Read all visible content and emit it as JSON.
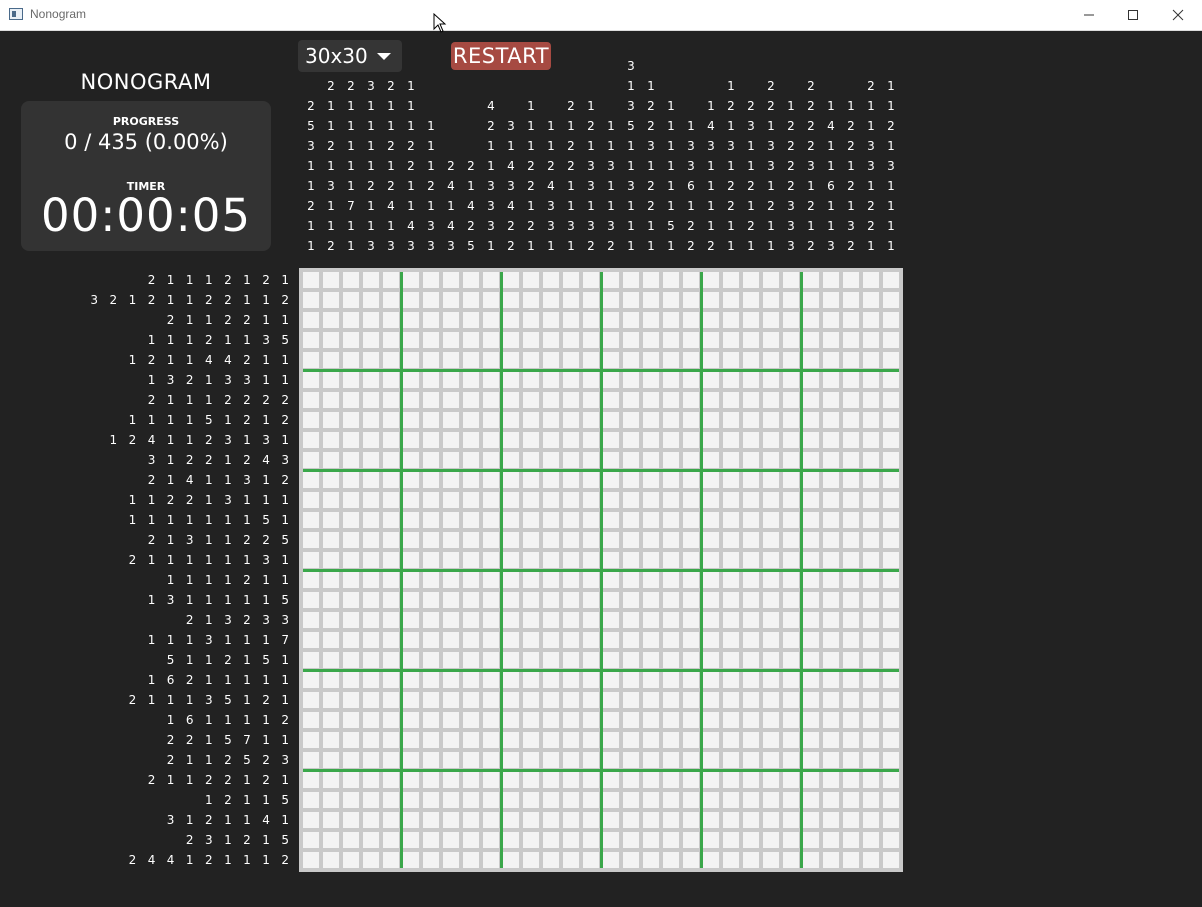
{
  "window": {
    "title": "Nonogram"
  },
  "game": {
    "heading": "NONOGRAM",
    "progress_label": "PROGRESS",
    "progress_value": "0 / 435 (0.00%)",
    "timer_label": "TIMER",
    "timer_value": "00:00:05",
    "size_select": "30x30",
    "restart_label": "RESTART",
    "accent_color": "#3aa74a",
    "restart_color": "#a64a42"
  },
  "puzzle": {
    "rows": 30,
    "cols": 30,
    "filled_cells": [],
    "column_clues": [
      [
        "2",
        "5",
        "3",
        "1",
        "1",
        "2",
        "1",
        "1"
      ],
      [
        "2",
        "1",
        "1",
        "2",
        "1",
        "3",
        "1",
        "1",
        "2"
      ],
      [
        "2",
        "1",
        "1",
        "1",
        "1",
        "1",
        "7",
        "1",
        "1"
      ],
      [
        "3",
        "1",
        "1",
        "1",
        "1",
        "2",
        "1",
        "1",
        "3"
      ],
      [
        "2",
        "1",
        "1",
        "2",
        "1",
        "2",
        "4",
        "1",
        "3"
      ],
      [
        "1",
        "1",
        "1",
        "2",
        "2",
        "1",
        "1",
        "4",
        "3"
      ],
      [
        "1",
        "1",
        "1",
        "2",
        "1",
        "3",
        "3"
      ],
      [
        "2",
        "4",
        "1",
        "4",
        "3"
      ],
      [
        "2",
        "1",
        "4",
        "2",
        "5"
      ],
      [
        "4",
        "2",
        "1",
        "1",
        "3",
        "3",
        "3",
        "1"
      ],
      [
        "3",
        "1",
        "4",
        "3",
        "4",
        "2",
        "2"
      ],
      [
        "1",
        "1",
        "1",
        "2",
        "2",
        "1",
        "2",
        "1"
      ],
      [
        "1",
        "1",
        "2",
        "4",
        "3",
        "3",
        "1"
      ],
      [
        "2",
        "1",
        "2",
        "2",
        "1",
        "1",
        "3",
        "1"
      ],
      [
        "1",
        "2",
        "1",
        "3",
        "3",
        "1",
        "3",
        "2"
      ],
      [
        "1",
        "1",
        "3",
        "1",
        "1",
        "3",
        "2"
      ],
      [
        "3",
        "1",
        "3",
        "5",
        "1",
        "1",
        "3",
        "1",
        "1",
        "1"
      ],
      [
        "1",
        "2",
        "2",
        "3",
        "1",
        "2",
        "2",
        "1",
        "1"
      ],
      [
        "1",
        "1",
        "1",
        "1",
        "1",
        "1",
        "5",
        "1"
      ],
      [
        "1",
        "3",
        "3",
        "6",
        "1",
        "2",
        "2"
      ],
      [
        "1",
        "4",
        "3",
        "1",
        "1",
        "1",
        "1",
        "2"
      ],
      [
        "1",
        "2",
        "1",
        "3",
        "1",
        "2",
        "2",
        "1",
        "1"
      ],
      [
        "2",
        "3",
        "1",
        "1",
        "2",
        "1",
        "2",
        "1"
      ],
      [
        "2",
        "2",
        "1",
        "3",
        "3",
        "1",
        "2",
        "1",
        "1"
      ],
      [
        "1",
        "2",
        "2",
        "2",
        "2",
        "3",
        "3",
        "3"
      ],
      [
        "2",
        "2",
        "2",
        "2",
        "3",
        "1",
        "2",
        "1",
        "2"
      ],
      [
        "1",
        "4",
        "1",
        "1",
        "6",
        "1",
        "1",
        "3"
      ],
      [
        "1",
        "2",
        "2",
        "1",
        "2",
        "1",
        "3",
        "2"
      ],
      [
        "2",
        "1",
        "1",
        "3",
        "3",
        "1",
        "2",
        "2",
        "1"
      ],
      [
        "1",
        "1",
        "2",
        "1",
        "3",
        "1",
        "1",
        "1",
        "1"
      ]
    ],
    "row_clues": [
      [
        "2",
        "1",
        "1",
        "1",
        "2",
        "1",
        "2",
        "1"
      ],
      [
        "3",
        "2",
        "1",
        "2",
        "1",
        "1",
        "2",
        "2",
        "1",
        "1",
        "2"
      ],
      [
        "2",
        "1",
        "1",
        "2",
        "2",
        "1",
        "1"
      ],
      [
        "1",
        "1",
        "1",
        "2",
        "1",
        "1",
        "3",
        "5"
      ],
      [
        "1",
        "2",
        "1",
        "1",
        "4",
        "4",
        "2",
        "1",
        "1"
      ],
      [
        "1",
        "3",
        "2",
        "1",
        "3",
        "3",
        "1",
        "1"
      ],
      [
        "2",
        "1",
        "1",
        "1",
        "2",
        "2",
        "2",
        "2"
      ],
      [
        "1",
        "1",
        "1",
        "1",
        "5",
        "1",
        "2",
        "1",
        "2"
      ],
      [
        "1",
        "2",
        "4",
        "1",
        "1",
        "2",
        "3",
        "1",
        "3",
        "1"
      ],
      [
        "3",
        "1",
        "2",
        "2",
        "1",
        "2",
        "4",
        "3"
      ],
      [
        "2",
        "1",
        "4",
        "1",
        "1",
        "3",
        "1",
        "2"
      ],
      [
        "1",
        "1",
        "2",
        "2",
        "1",
        "3",
        "1",
        "1",
        "1"
      ],
      [
        "1",
        "1",
        "1",
        "1",
        "1",
        "1",
        "1",
        "5",
        "1"
      ],
      [
        "2",
        "1",
        "3",
        "1",
        "1",
        "2",
        "2",
        "5"
      ],
      [
        "2",
        "1",
        "1",
        "1",
        "1",
        "1",
        "1",
        "3",
        "1"
      ],
      [
        "1",
        "1",
        "1",
        "1",
        "2",
        "1",
        "1"
      ],
      [
        "1",
        "3",
        "1",
        "1",
        "1",
        "1",
        "1",
        "5"
      ],
      [
        "2",
        "1",
        "3",
        "2",
        "3",
        "3"
      ],
      [
        "1",
        "1",
        "1",
        "3",
        "1",
        "1",
        "1",
        "7"
      ],
      [
        "5",
        "1",
        "1",
        "2",
        "1",
        "5",
        "1"
      ],
      [
        "1",
        "6",
        "2",
        "1",
        "1",
        "1",
        "1",
        "1"
      ],
      [
        "2",
        "1",
        "1",
        "1",
        "3",
        "5",
        "1",
        "2",
        "1"
      ],
      [
        "1",
        "6",
        "1",
        "1",
        "1",
        "1",
        "2"
      ],
      [
        "2",
        "2",
        "1",
        "5",
        "7",
        "1",
        "1"
      ],
      [
        "2",
        "1",
        "1",
        "2",
        "5",
        "2",
        "3"
      ],
      [
        "2",
        "1",
        "1",
        "2",
        "2",
        "1",
        "2",
        "1"
      ],
      [
        "1",
        "2",
        "1",
        "1",
        "5"
      ],
      [
        "3",
        "1",
        "2",
        "1",
        "1",
        "4",
        "1"
      ],
      [
        "2",
        "3",
        "1",
        "2",
        "1",
        "5"
      ],
      [
        "2",
        "4",
        "4",
        "1",
        "2",
        "1",
        "1",
        "1",
        "2"
      ]
    ]
  }
}
